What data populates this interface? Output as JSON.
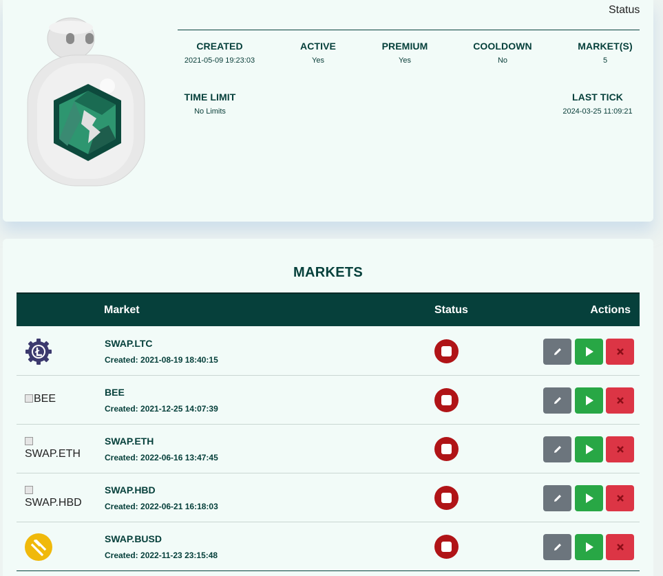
{
  "header": {
    "status_label": "Status"
  },
  "stats": {
    "created": {
      "label": "CREATED",
      "value": "2021-05-09 19:23:03"
    },
    "active": {
      "label": "ACTIVE",
      "value": "Yes"
    },
    "premium": {
      "label": "PREMIUM",
      "value": "Yes"
    },
    "cooldown": {
      "label": "COOLDOWN",
      "value": "No"
    },
    "markets": {
      "label": "MARKET(S)",
      "value": "5"
    },
    "time_limit": {
      "label": "TIME LIMIT",
      "value": "No Limits"
    },
    "last_tick": {
      "label": "LAST TICK",
      "value": "2024-03-25 11:09:21"
    }
  },
  "markets": {
    "title": "MARKETS",
    "columns": {
      "market": "Market",
      "status": "Status",
      "actions": "Actions"
    },
    "rows": [
      {
        "name": "SWAP.LTC",
        "created": "Created: 2021-08-19 18:40:15",
        "icon": "ltc-gear-icon"
      },
      {
        "name": "BEE",
        "created": "Created: 2021-12-25 14:07:39",
        "icon_alt": "BEE"
      },
      {
        "name": "SWAP.ETH",
        "created": "Created: 2022-06-16 13:47:45",
        "icon_alt": "SWAP.ETH"
      },
      {
        "name": "SWAP.HBD",
        "created": "Created: 2022-06-21 16:18:03",
        "icon_alt": "SWAP.HBD"
      },
      {
        "name": "SWAP.BUSD",
        "created": "Created: 2022-11-23 23:15:48",
        "icon": "busd-coin-icon"
      }
    ]
  },
  "colors": {
    "primary": "#06403b",
    "stop": "#b01417",
    "edit": "#6c757d",
    "start": "#28a745",
    "delete": "#dc3545",
    "busd": "#f0b90b"
  }
}
